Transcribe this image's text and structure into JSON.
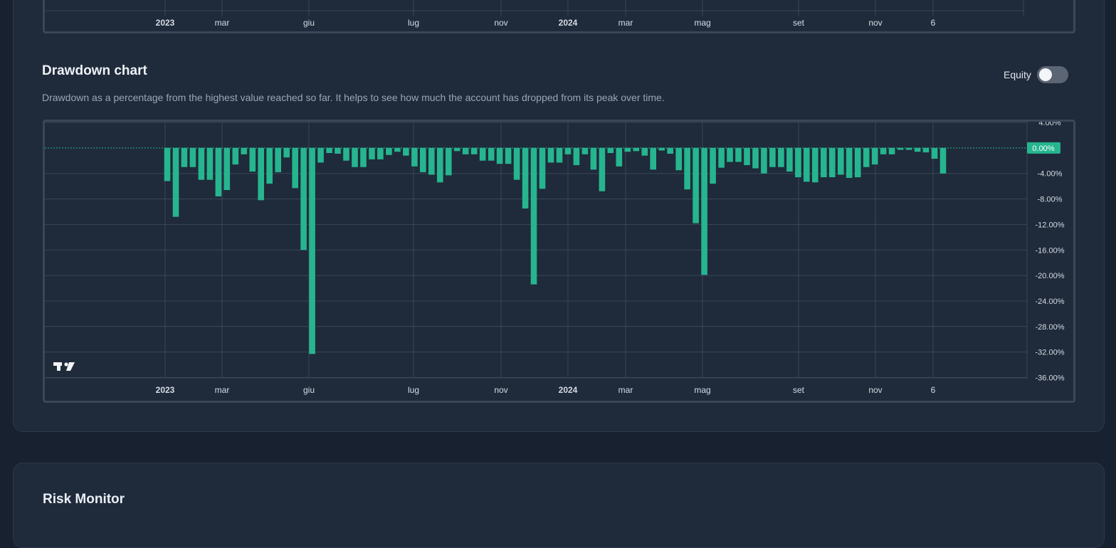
{
  "top_chart": {
    "x_labels": [
      {
        "text": "2023",
        "bold": true
      },
      {
        "text": "mar",
        "bold": false
      },
      {
        "text": "giu",
        "bold": false
      },
      {
        "text": "lug",
        "bold": false
      },
      {
        "text": "nov",
        "bold": false
      },
      {
        "text": "2024",
        "bold": true
      },
      {
        "text": "mar",
        "bold": false
      },
      {
        "text": "mag",
        "bold": false
      },
      {
        "text": "set",
        "bold": false
      },
      {
        "text": "nov",
        "bold": false
      },
      {
        "text": "6",
        "bold": false
      }
    ]
  },
  "drawdown": {
    "title": "Drawdown chart",
    "description": "Drawdown as a percentage from the highest value reached so far. It helps to see how much the account has dropped from its peak over time.",
    "toggle_label": "Equity",
    "toggle_on": false
  },
  "next_section": {
    "title": "Risk Monitor"
  },
  "colors": {
    "bar": "#26b58f",
    "badge": "#26b58f",
    "grid": "#3a4758",
    "axis_text": "#d6dce5"
  },
  "chart_data": {
    "type": "bar",
    "ylabel_unit": "%",
    "ylim": [
      -36,
      4
    ],
    "y_ticks": [
      "4.00%",
      "0.00%",
      "-4.00%",
      "-8.00%",
      "-12.00%",
      "-16.00%",
      "-20.00%",
      "-24.00%",
      "-28.00%",
      "-32.00%",
      "-36.00%"
    ],
    "current_value_label": "0.00%",
    "x_labels": [
      {
        "text": "2023",
        "bold": true
      },
      {
        "text": "mar",
        "bold": false
      },
      {
        "text": "giu",
        "bold": false
      },
      {
        "text": "lug",
        "bold": false
      },
      {
        "text": "nov",
        "bold": false
      },
      {
        "text": "2024",
        "bold": true
      },
      {
        "text": "mar",
        "bold": false
      },
      {
        "text": "mag",
        "bold": false
      },
      {
        "text": "set",
        "bold": false
      },
      {
        "text": "nov",
        "bold": false
      },
      {
        "text": "6",
        "bold": false
      }
    ],
    "bars": [
      -5.2,
      -10.8,
      -3.0,
      -3.0,
      -5.0,
      -5.0,
      -7.6,
      -6.6,
      -2.6,
      -1.0,
      -3.7,
      -8.2,
      -5.6,
      -3.8,
      -1.5,
      -6.3,
      -16.0,
      -32.3,
      -2.3,
      -0.8,
      -0.9,
      -2.0,
      -3.0,
      -3.0,
      -1.8,
      -1.8,
      -1.1,
      -0.6,
      -1.2,
      -2.9,
      -3.8,
      -4.2,
      -5.4,
      -4.3,
      -0.5,
      -1.0,
      -1.0,
      -2.0,
      -2.0,
      -2.5,
      -2.5,
      -5.0,
      -9.5,
      -21.4,
      -6.4,
      -2.3,
      -2.3,
      -1.0,
      -2.7,
      -1.0,
      -3.4,
      -6.8,
      -0.8,
      -2.9,
      -0.6,
      -0.5,
      -1.2,
      -3.4,
      -0.4,
      -0.9,
      -3.5,
      -6.5,
      -11.8,
      -19.9,
      -5.6,
      -3.1,
      -2.2,
      -2.2,
      -2.7,
      -3.2,
      -4.0,
      -3.0,
      -3.0,
      -3.7,
      -4.6,
      -5.3,
      -5.4,
      -4.6,
      -4.6,
      -4.2,
      -4.7,
      -4.6,
      -3.0,
      -2.6,
      -1.0,
      -1.0,
      -0.3,
      -0.3,
      -0.6,
      -0.7,
      -1.7,
      -4.0
    ]
  }
}
